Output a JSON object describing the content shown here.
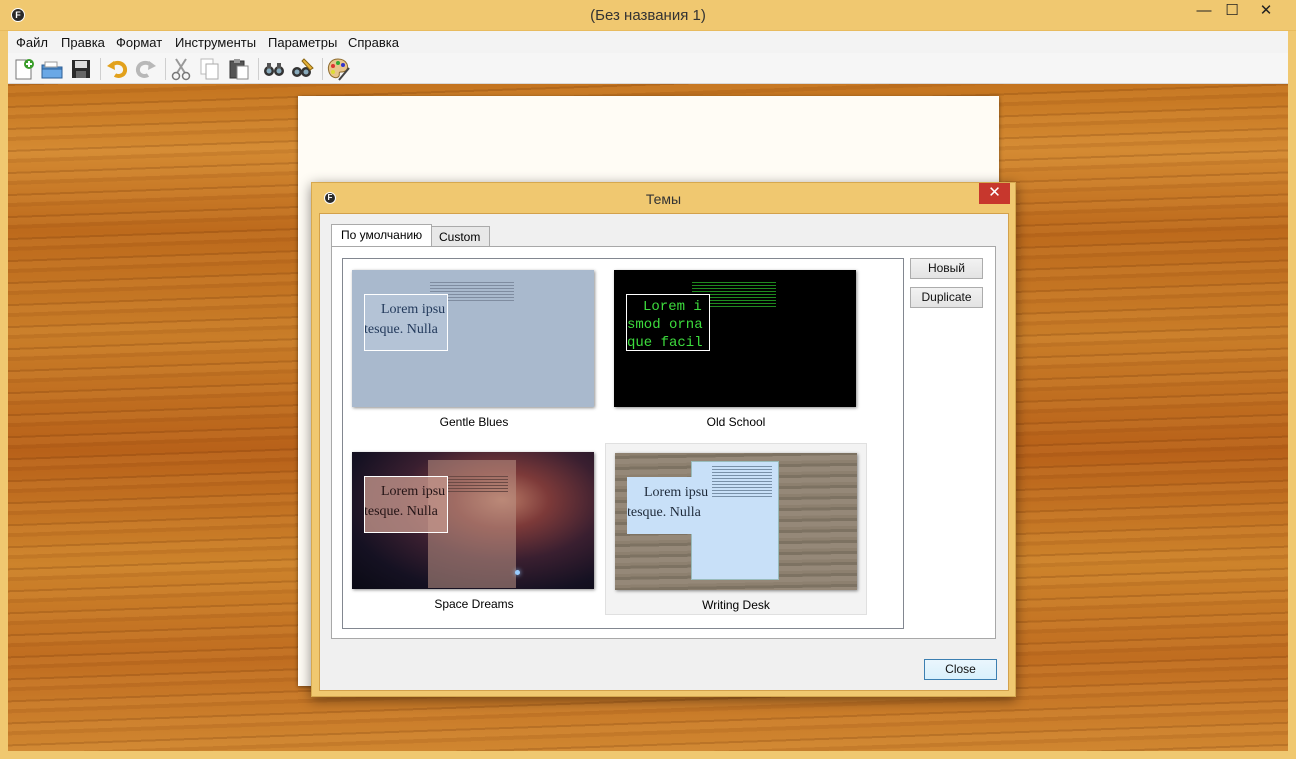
{
  "window": {
    "title": "(Без названия 1)",
    "app_icon_letter": "F",
    "minimize": "—",
    "maximize": "☐",
    "close": "✕"
  },
  "menu": [
    "Файл",
    "Правка",
    "Формат",
    "Инструменты",
    "Параметры",
    "Справка"
  ],
  "toolbar": [
    "new-document-icon",
    "open-folder-icon",
    "save-icon",
    "undo-icon",
    "redo-icon",
    "cut-icon",
    "copy-icon",
    "paste-icon",
    "find-icon",
    "find-replace-icon",
    "themes-palette-icon"
  ],
  "dialog": {
    "title": "Темы",
    "icon_letter": "F",
    "close": "✕",
    "tabs": [
      "По умолчанию",
      "Custom"
    ],
    "themes": [
      {
        "name": "Gentle Blues",
        "l1": "Lorem ipsu",
        "l2": "ntesque. Nulla",
        "l3": ""
      },
      {
        "name": "Old School",
        "l1": "Lorem i",
        "l2": "smod orna",
        "l3": "que facil"
      },
      {
        "name": "Space Dreams",
        "l1": "Lorem ipsu",
        "l2": "ntesque. Nulla",
        "l3": ""
      },
      {
        "name": "Writing Desk",
        "l1": "Lorem ipsu",
        "l2": "ntesque. Nulla",
        "l3": ""
      }
    ],
    "buttons": {
      "new": "Новый",
      "duplicate": "Duplicate",
      "close": "Close"
    }
  }
}
